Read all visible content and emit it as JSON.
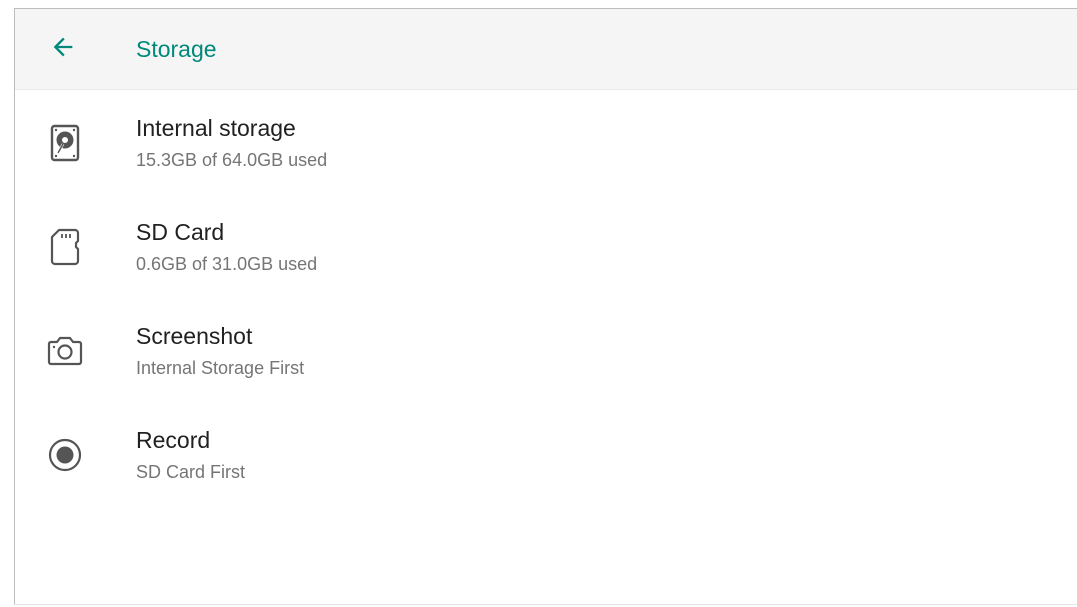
{
  "appbar": {
    "title": "Storage",
    "back_icon": "arrow-back-icon",
    "accent_color": "#00897b"
  },
  "items": [
    {
      "icon": "hard-disk-icon",
      "title": "Internal storage",
      "subtitle": "15.3GB of 64.0GB used"
    },
    {
      "icon": "sd-card-icon",
      "title": "SD Card",
      "subtitle": "0.6GB of 31.0GB used"
    },
    {
      "icon": "camera-icon",
      "title": "Screenshot",
      "subtitle": "Internal Storage First"
    },
    {
      "icon": "record-icon",
      "title": "Record",
      "subtitle": "SD Card First"
    }
  ]
}
